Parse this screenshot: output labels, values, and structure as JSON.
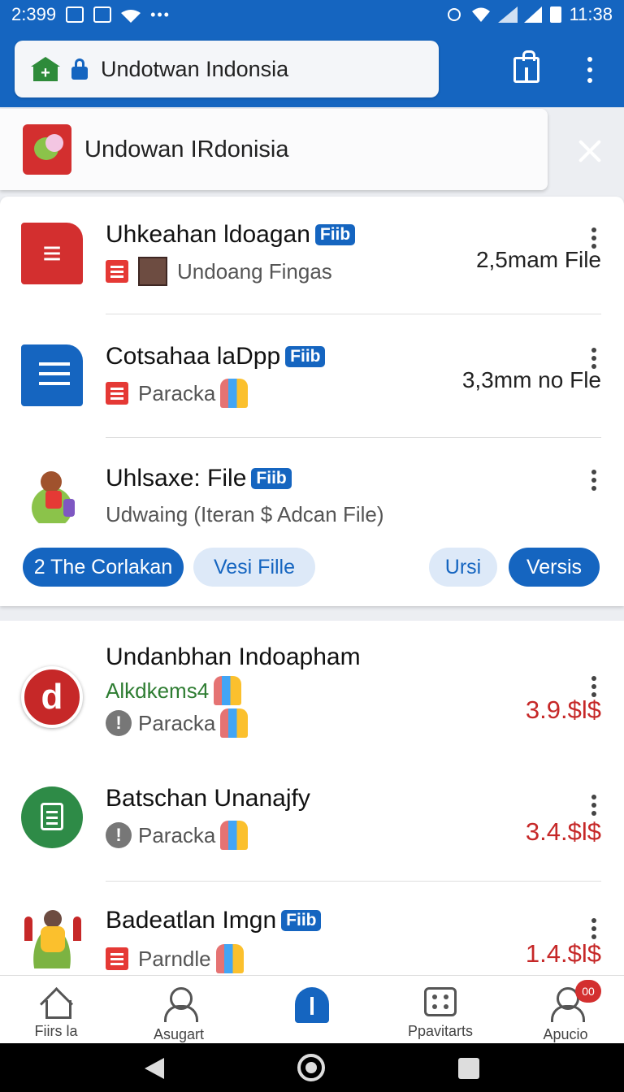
{
  "status_bar": {
    "time_left": "2:399",
    "time_right": "11:38"
  },
  "app_bar": {
    "url_text": "Undotwan Indonsia"
  },
  "banner": {
    "title": "Undowan IRdonisia"
  },
  "card1": {
    "rows": [
      {
        "title": "Uhkeahan ldoagan",
        "badge": "Fiib",
        "subtitle": "Undoang Fingas",
        "size": "2,5mam File"
      },
      {
        "title": "Cotsahaa laDpp",
        "badge": "Fiib",
        "subtitle": "Paracka",
        "size": "3,3mm no Fle"
      },
      {
        "title": "Uhlsaxe: File",
        "badge": "Fiib",
        "subtitle": "Udwaing (Iteran $ Adcan File)"
      }
    ],
    "chips": [
      {
        "label": "2 The Corlakan"
      },
      {
        "label": "Vesi Fille"
      },
      {
        "label": "Ursi"
      },
      {
        "label": "Versis"
      }
    ]
  },
  "card2": {
    "rows": [
      {
        "title": "Undanbhan Indoapham",
        "subtitle_green": "Alkdkems4",
        "subtitle": "Paracka",
        "price": "3.9.$l$"
      },
      {
        "title": "Batschan Unanajfy",
        "subtitle": "Paracka",
        "price": "3.4.$l$"
      },
      {
        "title": "Badeatlan Imgn",
        "badge": "Fiib",
        "subtitle": "Parndle",
        "price": "1.4.$l$"
      }
    ]
  },
  "bottom_nav": {
    "items": [
      {
        "label": "Fiirs la",
        "icon": "home-icon"
      },
      {
        "label": "Asugart",
        "icon": "user-icon"
      },
      {
        "label": "",
        "icon": "center-icon"
      },
      {
        "label": "Ppavitarts",
        "icon": "dice-icon"
      },
      {
        "label": "Apucio",
        "icon": "profile-icon"
      }
    ],
    "notification_badge": "00"
  },
  "colors": {
    "primary": "#1565c0",
    "danger": "#d32f2f",
    "success": "#2e7d32"
  }
}
